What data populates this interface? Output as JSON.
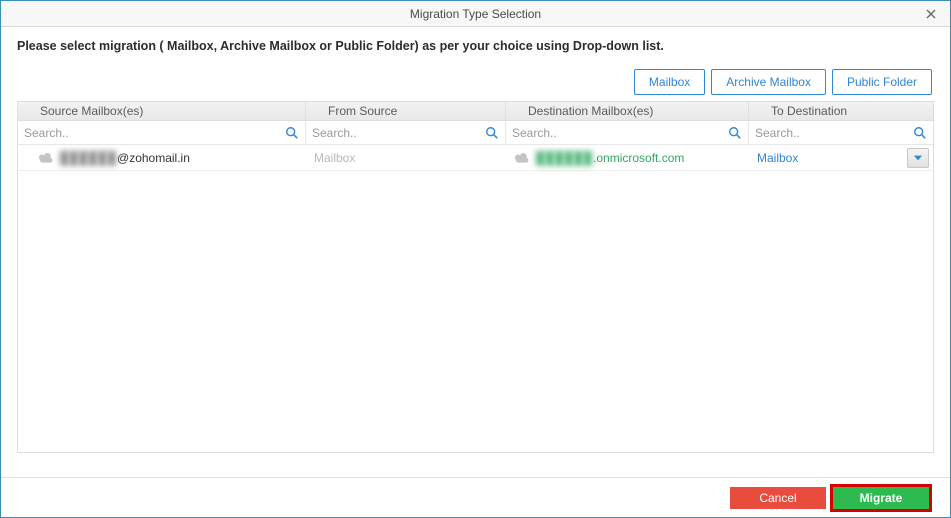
{
  "window": {
    "title": "Migration Type Selection"
  },
  "instruction": "Please select migration ( Mailbox, Archive Mailbox or Public Folder) as per your choice using Drop-down list.",
  "type_buttons": {
    "mailbox": "Mailbox",
    "archive_mailbox": "Archive Mailbox",
    "public_folder": "Public Folder"
  },
  "columns": {
    "source": "Source Mailbox(es)",
    "from": "From Source",
    "destination": "Destination Mailbox(es)",
    "to": "To Destination"
  },
  "search": {
    "placeholder": "Search.."
  },
  "row": {
    "source_masked": "██████",
    "source_domain": "@zohomail.in",
    "from_source": "Mailbox",
    "destination_masked": "██████",
    "destination_domain": ".onmicrosoft.com",
    "to_destination": "Mailbox"
  },
  "footer": {
    "cancel": "Cancel",
    "migrate": "Migrate"
  }
}
